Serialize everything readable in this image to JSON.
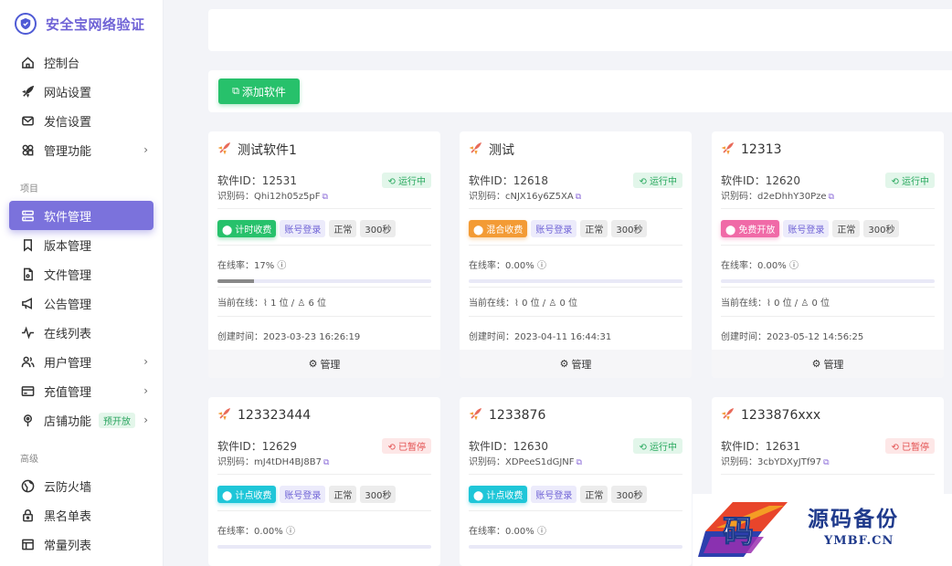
{
  "brand": {
    "title": "安全宝网络验证"
  },
  "sidebar": {
    "items_top": [
      {
        "label": "控制台",
        "icon": "home-icon"
      },
      {
        "label": "网站设置",
        "icon": "rocket-icon"
      },
      {
        "label": "发信设置",
        "icon": "mail-icon"
      },
      {
        "label": "管理功能",
        "icon": "tiles-icon",
        "chevron": true
      }
    ],
    "section_project": "项目",
    "items_project": [
      {
        "label": "软件管理",
        "icon": "server-icon",
        "active": true
      },
      {
        "label": "版本管理",
        "icon": "bookmark-icon"
      },
      {
        "label": "文件管理",
        "icon": "file-icon"
      },
      {
        "label": "公告管理",
        "icon": "megaphone-icon"
      },
      {
        "label": "在线列表",
        "icon": "pulse-icon"
      },
      {
        "label": "用户管理",
        "icon": "users-icon",
        "chevron": true
      },
      {
        "label": "充值管理",
        "icon": "card-icon",
        "chevron": true
      },
      {
        "label": "店铺功能",
        "icon": "pin-icon",
        "chevron": true,
        "badge": "预开放"
      }
    ],
    "section_advanced": "高级",
    "items_advanced": [
      {
        "label": "云防火墙",
        "icon": "globe-icon"
      },
      {
        "label": "黑名单表",
        "icon": "lock-icon"
      },
      {
        "label": "常量列表",
        "icon": "table-icon"
      }
    ]
  },
  "toolbar": {
    "add_label": "添加软件"
  },
  "labels": {
    "id_prefix": "软件ID：",
    "code_prefix": "识别码：",
    "rate_prefix": "在线率：",
    "current_prefix": "当前在线：",
    "created_prefix": "创建时间：",
    "manage": "管理"
  },
  "cards": [
    {
      "name": "测试软件1",
      "id": "12531",
      "code": "Qhi12h05z5pF",
      "status": "运行中",
      "status_type": "run",
      "charge": "计时收费",
      "charge_type": "t-green",
      "login": "账号登录",
      "state": "正常",
      "interval": "300秒",
      "rate": "17%",
      "rate_value": 17,
      "online": "1 位",
      "total": "6 位",
      "created": "2023-03-23 16:26:19"
    },
    {
      "name": "测试",
      "id": "12618",
      "code": "cNJX16y6Z5XA",
      "status": "运行中",
      "status_type": "run",
      "charge": "混合收费",
      "charge_type": "t-orange",
      "login": "账号登录",
      "state": "正常",
      "interval": "300秒",
      "rate": "0.00%",
      "rate_value": 0,
      "online": "0 位",
      "total": "0 位",
      "created": "2023-04-11 16:44:31"
    },
    {
      "name": "12313",
      "id": "12620",
      "code": "d2eDhhY30Pze",
      "status": "运行中",
      "status_type": "run",
      "charge": "免费开放",
      "charge_type": "t-pink",
      "login": "账号登录",
      "state": "正常",
      "interval": "300秒",
      "rate": "0.00%",
      "rate_value": 0,
      "online": "0 位",
      "total": "0 位",
      "created": "2023-05-12 14:56:25"
    },
    {
      "name": "123323444",
      "id": "12629",
      "code": "mJ4tDH4BJ8B7",
      "status": "已暂停",
      "status_type": "stop",
      "charge": "计点收费",
      "charge_type": "t-cyan",
      "login": "账号登录",
      "state": "正常",
      "interval": "300秒",
      "rate": "0.00%",
      "rate_value": 0
    },
    {
      "name": "1233876",
      "id": "12630",
      "code": "XDPeeS1dGJNF",
      "status": "运行中",
      "status_type": "run",
      "charge": "计点收费",
      "charge_type": "t-cyan",
      "login": "账号登录",
      "state": "正常",
      "interval": "300秒",
      "rate": "0.00%",
      "rate_value": 0
    },
    {
      "name": "1233876xxx",
      "id": "12631",
      "code": "3cbYDXyJTf97",
      "status": "已暂停",
      "status_type": "stop"
    }
  ],
  "watermark": {
    "text": "源码备份",
    "sub": "YMBF.CN",
    "logo_char": "码"
  },
  "colors": {
    "accent": "#7b72dc",
    "green": "#27c16b",
    "cyan": "#1fc6d8",
    "orange": "#f39b35",
    "pink": "#f06aa7"
  }
}
